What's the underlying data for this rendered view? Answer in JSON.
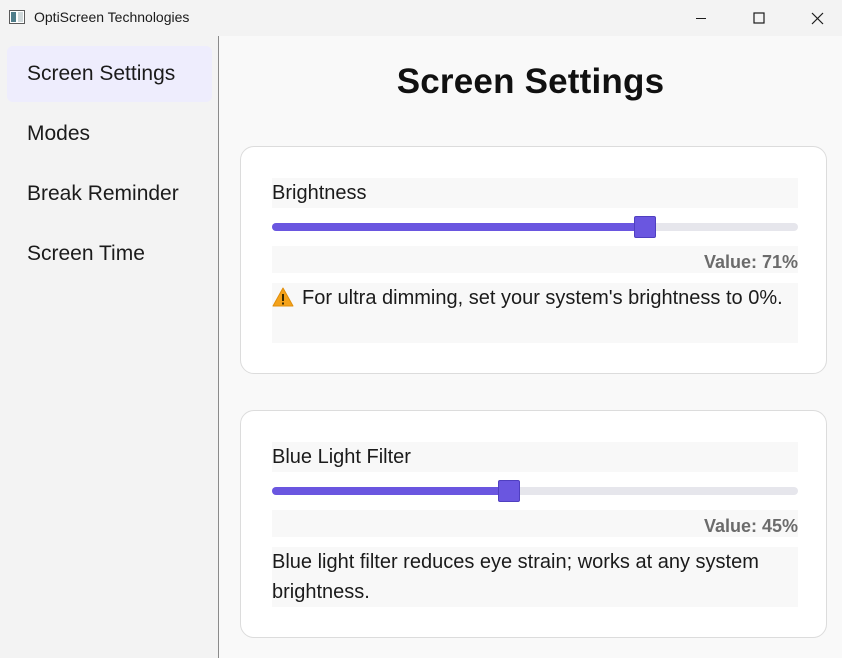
{
  "window": {
    "title": "OptiScreen Technologies",
    "icons": [
      "app-icon",
      "minimize-icon",
      "maximize-icon",
      "close-icon"
    ]
  },
  "sidebar": {
    "items": [
      {
        "label": "Screen Settings",
        "active": true
      },
      {
        "label": "Modes",
        "active": false
      },
      {
        "label": "Break Reminder",
        "active": false
      },
      {
        "label": "Screen Time",
        "active": false
      }
    ]
  },
  "main": {
    "title": "Screen Settings",
    "brightness": {
      "label": "Brightness",
      "value": 71,
      "value_text": "Value: 71%",
      "note_icon": "warning-icon",
      "note": "For ultra dimming, set your system's brightness to 0%."
    },
    "blue_light": {
      "label": "Blue Light Filter",
      "value": 45,
      "value_text": "Value: 45%",
      "note": "Blue light filter reduces eye strain; works at any system brightness."
    }
  },
  "colors": {
    "accent": "#6a56e0",
    "active_nav_bg": "#eeedfd",
    "track": "#e6e6ec",
    "value_text": "#6b6b6b",
    "warning": "#f4a21b"
  }
}
